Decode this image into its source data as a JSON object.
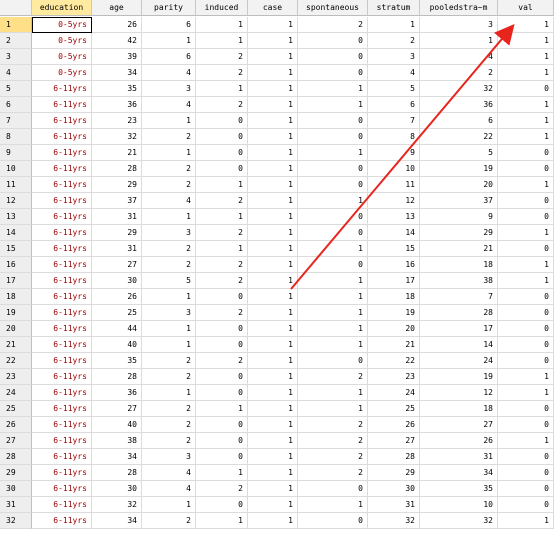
{
  "columns": [
    "education",
    "age",
    "parity",
    "induced",
    "case",
    "spontaneous",
    "stratum",
    "pooledstra~m",
    "val"
  ],
  "rows": [
    {
      "n": "1",
      "edu": "0-5yrs",
      "v": [
        "26",
        "6",
        "1",
        "1",
        "2",
        "1",
        "3",
        "1"
      ]
    },
    {
      "n": "2",
      "edu": "0-5yrs",
      "v": [
        "42",
        "1",
        "1",
        "1",
        "0",
        "2",
        "1",
        "1"
      ]
    },
    {
      "n": "3",
      "edu": "0-5yrs",
      "v": [
        "39",
        "6",
        "2",
        "1",
        "0",
        "3",
        "4",
        "1"
      ]
    },
    {
      "n": "4",
      "edu": "0-5yrs",
      "v": [
        "34",
        "4",
        "2",
        "1",
        "0",
        "4",
        "2",
        "1"
      ]
    },
    {
      "n": "5",
      "edu": "6-11yrs",
      "v": [
        "35",
        "3",
        "1",
        "1",
        "1",
        "5",
        "32",
        "0"
      ]
    },
    {
      "n": "6",
      "edu": "6-11yrs",
      "v": [
        "36",
        "4",
        "2",
        "1",
        "1",
        "6",
        "36",
        "1"
      ]
    },
    {
      "n": "7",
      "edu": "6-11yrs",
      "v": [
        "23",
        "1",
        "0",
        "1",
        "0",
        "7",
        "6",
        "1"
      ]
    },
    {
      "n": "8",
      "edu": "6-11yrs",
      "v": [
        "32",
        "2",
        "0",
        "1",
        "0",
        "8",
        "22",
        "1"
      ]
    },
    {
      "n": "9",
      "edu": "6-11yrs",
      "v": [
        "21",
        "1",
        "0",
        "1",
        "1",
        "9",
        "5",
        "0"
      ]
    },
    {
      "n": "10",
      "edu": "6-11yrs",
      "v": [
        "28",
        "2",
        "0",
        "1",
        "0",
        "10",
        "19",
        "0"
      ]
    },
    {
      "n": "11",
      "edu": "6-11yrs",
      "v": [
        "29",
        "2",
        "1",
        "1",
        "0",
        "11",
        "20",
        "1"
      ]
    },
    {
      "n": "12",
      "edu": "6-11yrs",
      "v": [
        "37",
        "4",
        "2",
        "1",
        "1",
        "12",
        "37",
        "0"
      ]
    },
    {
      "n": "13",
      "edu": "6-11yrs",
      "v": [
        "31",
        "1",
        "1",
        "1",
        "0",
        "13",
        "9",
        "0"
      ]
    },
    {
      "n": "14",
      "edu": "6-11yrs",
      "v": [
        "29",
        "3",
        "2",
        "1",
        "0",
        "14",
        "29",
        "1"
      ]
    },
    {
      "n": "15",
      "edu": "6-11yrs",
      "v": [
        "31",
        "2",
        "1",
        "1",
        "1",
        "15",
        "21",
        "0"
      ]
    },
    {
      "n": "16",
      "edu": "6-11yrs",
      "v": [
        "27",
        "2",
        "2",
        "1",
        "0",
        "16",
        "18",
        "1"
      ]
    },
    {
      "n": "17",
      "edu": "6-11yrs",
      "v": [
        "30",
        "5",
        "2",
        "1",
        "1",
        "17",
        "38",
        "1"
      ]
    },
    {
      "n": "18",
      "edu": "6-11yrs",
      "v": [
        "26",
        "1",
        "0",
        "1",
        "1",
        "18",
        "7",
        "0"
      ]
    },
    {
      "n": "19",
      "edu": "6-11yrs",
      "v": [
        "25",
        "3",
        "2",
        "1",
        "1",
        "19",
        "28",
        "0"
      ]
    },
    {
      "n": "20",
      "edu": "6-11yrs",
      "v": [
        "44",
        "1",
        "0",
        "1",
        "1",
        "20",
        "17",
        "0"
      ]
    },
    {
      "n": "21",
      "edu": "6-11yrs",
      "v": [
        "40",
        "1",
        "0",
        "1",
        "1",
        "21",
        "14",
        "0"
      ]
    },
    {
      "n": "22",
      "edu": "6-11yrs",
      "v": [
        "35",
        "2",
        "2",
        "1",
        "0",
        "22",
        "24",
        "0"
      ]
    },
    {
      "n": "23",
      "edu": "6-11yrs",
      "v": [
        "28",
        "2",
        "0",
        "1",
        "2",
        "23",
        "19",
        "1"
      ]
    },
    {
      "n": "24",
      "edu": "6-11yrs",
      "v": [
        "36",
        "1",
        "0",
        "1",
        "1",
        "24",
        "12",
        "1"
      ]
    },
    {
      "n": "25",
      "edu": "6-11yrs",
      "v": [
        "27",
        "2",
        "1",
        "1",
        "1",
        "25",
        "18",
        "0"
      ]
    },
    {
      "n": "26",
      "edu": "6-11yrs",
      "v": [
        "40",
        "2",
        "0",
        "1",
        "2",
        "26",
        "27",
        "0"
      ]
    },
    {
      "n": "27",
      "edu": "6-11yrs",
      "v": [
        "38",
        "2",
        "0",
        "1",
        "2",
        "27",
        "26",
        "1"
      ]
    },
    {
      "n": "28",
      "edu": "6-11yrs",
      "v": [
        "34",
        "3",
        "0",
        "1",
        "2",
        "28",
        "31",
        "0"
      ]
    },
    {
      "n": "29",
      "edu": "6-11yrs",
      "v": [
        "28",
        "4",
        "1",
        "1",
        "2",
        "29",
        "34",
        "0"
      ]
    },
    {
      "n": "30",
      "edu": "6-11yrs",
      "v": [
        "30",
        "4",
        "2",
        "1",
        "0",
        "30",
        "35",
        "0"
      ]
    },
    {
      "n": "31",
      "edu": "6-11yrs",
      "v": [
        "32",
        "1",
        "0",
        "1",
        "1",
        "31",
        "10",
        "0"
      ]
    },
    {
      "n": "32",
      "edu": "6-11yrs",
      "v": [
        "34",
        "2",
        "1",
        "1",
        "0",
        "32",
        "32",
        "1"
      ]
    }
  ],
  "colors": {
    "header_bg": "#f2f2f2",
    "selected_header": "#ffeaa0",
    "education_text": "#a00000",
    "arrow": "#e8251d"
  }
}
